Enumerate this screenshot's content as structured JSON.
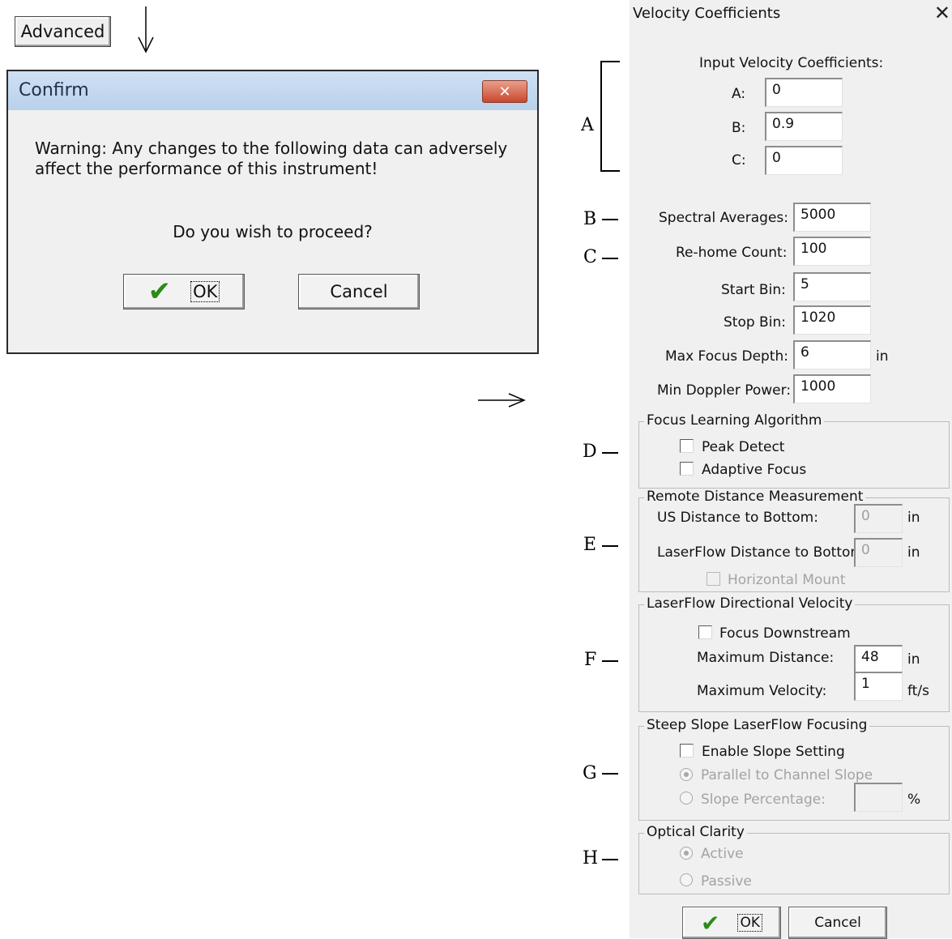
{
  "advanced_button": {
    "label": "Advanced"
  },
  "confirm": {
    "title": "Confirm",
    "close_glyph": "✕",
    "warning_line1": "Warning:  Any changes to the following data can adversely",
    "warning_line2": "affect the performance of this instrument!",
    "question": "Do you wish to proceed?",
    "ok_label": "OK",
    "cancel_label": "Cancel"
  },
  "annotations": {
    "A": "A",
    "B": "B",
    "C": "C",
    "D": "D",
    "E": "E",
    "F": "F",
    "G": "G",
    "H": "H"
  },
  "velocity": {
    "title": "Velocity Coefficients",
    "close_glyph": "✕",
    "input_header": "Input Velocity Coefficients:",
    "a_label": "A:",
    "a_value": "0",
    "b_label": "B:",
    "b_value": "0.9",
    "c_label": "C:",
    "c_value": "0",
    "spectral_label": "Spectral Averages:",
    "spectral_value": "5000",
    "rehome_label": "Re-home Count:",
    "rehome_value": "100",
    "startbin_label": "Start Bin:",
    "startbin_value": "5",
    "stopbin_label": "Stop Bin:",
    "stopbin_value": "1020",
    "maxfocus_label": "Max Focus Depth:",
    "maxfocus_value": "6",
    "maxfocus_unit": "in",
    "mindoppler_label": "Min Doppler Power:",
    "mindoppler_value": "1000",
    "focus_group": "Focus Learning Algorithm",
    "peak_detect": "Peak Detect",
    "adaptive_focus": "Adaptive Focus",
    "remote_group": "Remote Distance Measurement",
    "us_distance_label": "US Distance to Bottom:",
    "us_distance_value": "0",
    "us_distance_unit": "in",
    "lf_distance_label": "LaserFlow Distance to Bottom:",
    "lf_distance_value": "0",
    "lf_distance_unit": "in",
    "horizontal_mount": "Horizontal Mount",
    "directional_group": "LaserFlow Directional Velocity",
    "focus_downstream": "Focus Downstream",
    "max_distance_label": "Maximum Distance:",
    "max_distance_value": "48",
    "max_distance_unit": "in",
    "max_velocity_label": "Maximum Velocity:",
    "max_velocity_value": "1",
    "max_velocity_unit": "ft/s",
    "slope_group": "Steep Slope LaserFlow Focusing",
    "enable_slope": "Enable Slope Setting",
    "parallel_slope": "Parallel to Channel Slope",
    "slope_percentage": "Slope Percentage:",
    "slope_unit": "%",
    "clarity_group": "Optical Clarity",
    "active": "Active",
    "passive": "Passive",
    "ok_label": "OK",
    "cancel_label": "Cancel"
  }
}
